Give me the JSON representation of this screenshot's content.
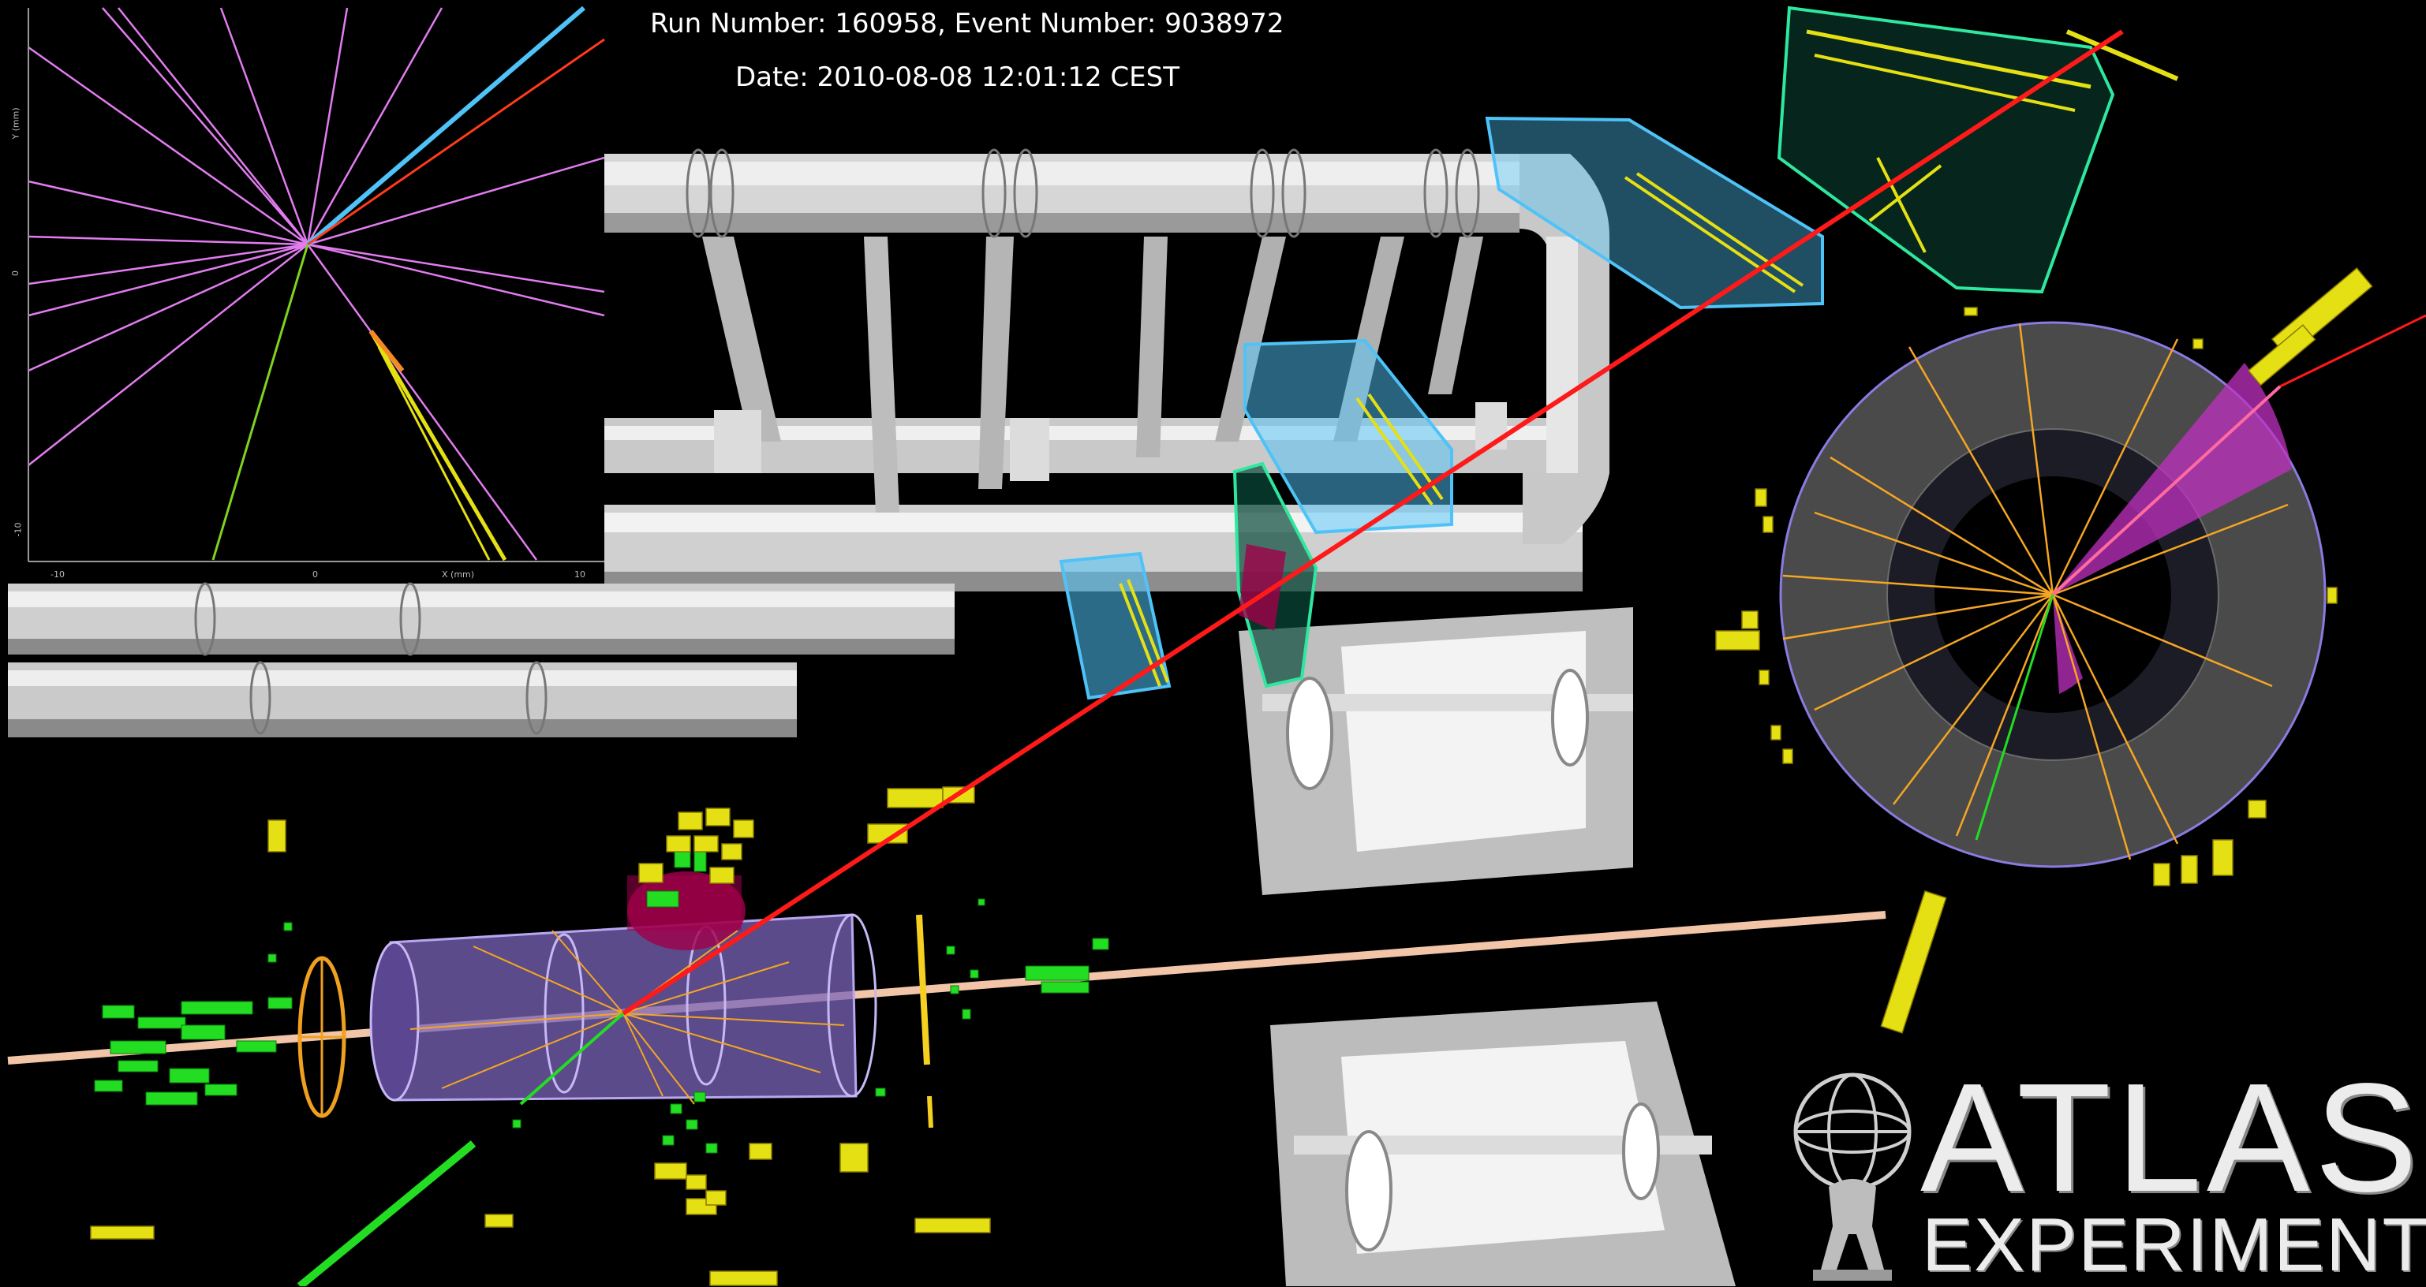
{
  "header": {
    "run_text": "Run Number: 160958, Event Number: 9038972",
    "date_text": "Date: 2010-08-08 12:01:12 CEST"
  },
  "inset": {
    "x_axis_label": "X (mm)",
    "y_axis_label": "Y (mm)",
    "x_ticks": [
      "-10",
      "0",
      "10"
    ],
    "y_ticks": [
      "-10",
      "0"
    ]
  },
  "logo": {
    "line1": "ATLAS",
    "line2": "EXPERIMENT"
  },
  "colors": {
    "background": "#000000",
    "muon_track": "#ff1a1a",
    "tracks": "#f5a623",
    "inner_detector_hits": "#ffffff",
    "calorimeter_deposit": "#e5e013",
    "muon_chamber_blue": "#4fc3f7",
    "muon_chamber_green": "#2ee8a0",
    "jet_cone": "#e040c8",
    "pixel_hits": "#22dd22",
    "inset_tracks": "#e27cf0"
  }
}
